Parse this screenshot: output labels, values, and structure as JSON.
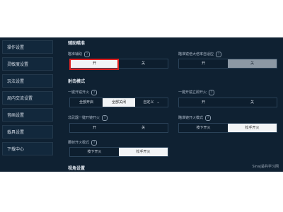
{
  "sidebar": {
    "items": [
      {
        "label": "操作设置"
      },
      {
        "label": "灵敏度设置"
      },
      {
        "label": "玩法设置"
      },
      {
        "label": "局内交流设置"
      },
      {
        "label": "音画设置"
      },
      {
        "label": "载具设置"
      },
      {
        "label": "下载中心"
      }
    ]
  },
  "sections": {
    "aim_assist": {
      "title": "辅助瞄准",
      "aim_assist_label": "瞄准辅助",
      "aim_assist_options": [
        "开",
        "关"
      ],
      "scope_adapt_label": "瞄准镜倍大倍率自适应",
      "scope_adapt_options": [
        "开",
        "关"
      ]
    },
    "fire_mode": {
      "title": "射击模式",
      "one_tap_fire_label": "一键开镜开火",
      "one_tap_fire_options": [
        "全部开启",
        "全部关闭",
        "自定义"
      ],
      "independent_fire_label": "一键开镜立即开火",
      "independent_fire_options": [
        "开",
        "关"
      ],
      "semi_auto_label": "非武器一键开镜开火",
      "semi_auto_options": [
        "开",
        "关"
      ],
      "scope_fire_mode_label": "瞄准镜开火模式",
      "scope_fire_mode_options": [
        "按下开火",
        "松手开火"
      ],
      "hipfire_mode_label": "腰射开火模式",
      "hipfire_mode_options": [
        "按下开火",
        "松手开火"
      ]
    },
    "view": {
      "title": "视角设置"
    }
  },
  "help_icon_text": "?",
  "watermark": "Sina|楚兵学习网"
}
